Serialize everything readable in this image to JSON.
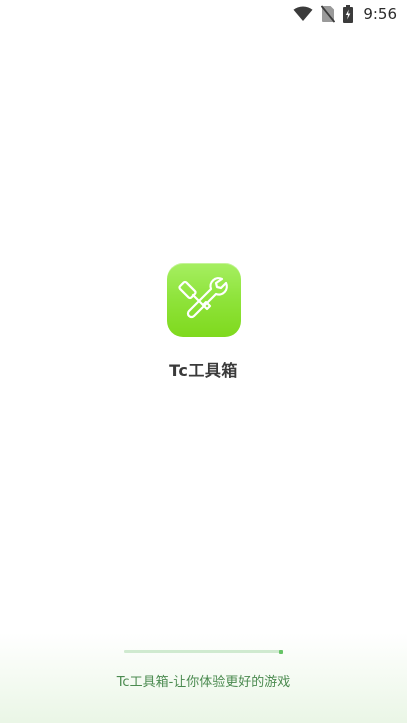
{
  "status_bar": {
    "time": "9:56",
    "icons": [
      "wifi-icon",
      "no-sim-icon",
      "battery-charging-icon"
    ]
  },
  "app": {
    "name": "Tc工具箱",
    "icon": "wrench-screwdriver-icon",
    "icon_color": "#8fe33c"
  },
  "loading": {
    "progress": 1.0,
    "accent_color": "#66c466"
  },
  "footer": {
    "slogan": "Tc工具箱-让你体验更好的游戏"
  }
}
